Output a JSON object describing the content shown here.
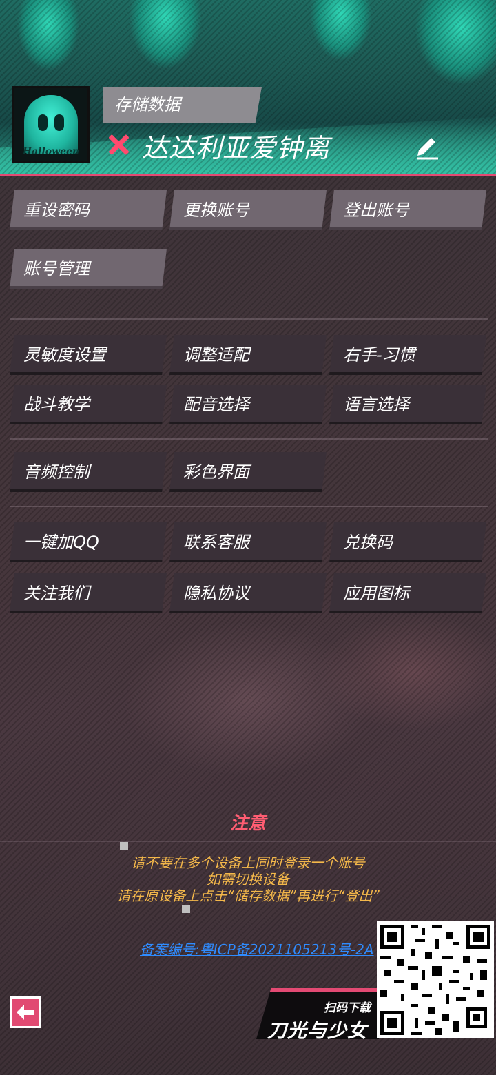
{
  "header": {
    "save_label": "存储数据",
    "username": "达达利亚爱钟离",
    "avatar_text": "Halloween"
  },
  "account_buttons": [
    "重设密码",
    "更换账号",
    "登出账号",
    "账号管理"
  ],
  "settings_buttons": [
    "灵敏度设置",
    "调整适配",
    "右手-习惯",
    "战斗教学",
    "配音选择",
    "语言选择",
    "音频控制",
    "彩色界面"
  ],
  "social_buttons": [
    "一键加QQ",
    "联系客服",
    "兑换码",
    "关注我们",
    "隐私协议",
    "应用图标"
  ],
  "notice": {
    "title": "注意",
    "lines": [
      "请不要在多个设备上同时登录一个账号",
      "如需切换设备",
      "请在原设备上点击“储存数据”再进行“登出”"
    ]
  },
  "icp_link": "备案编号:粤ICP备2021105213号-2A",
  "download": {
    "small": "扫码下载",
    "big": "刀光与少女"
  },
  "colors": {
    "accent_pink": "#e34a73",
    "notice_title": "#ff5d72",
    "notice_text": "#f4b84a",
    "link": "#2f8cff"
  }
}
